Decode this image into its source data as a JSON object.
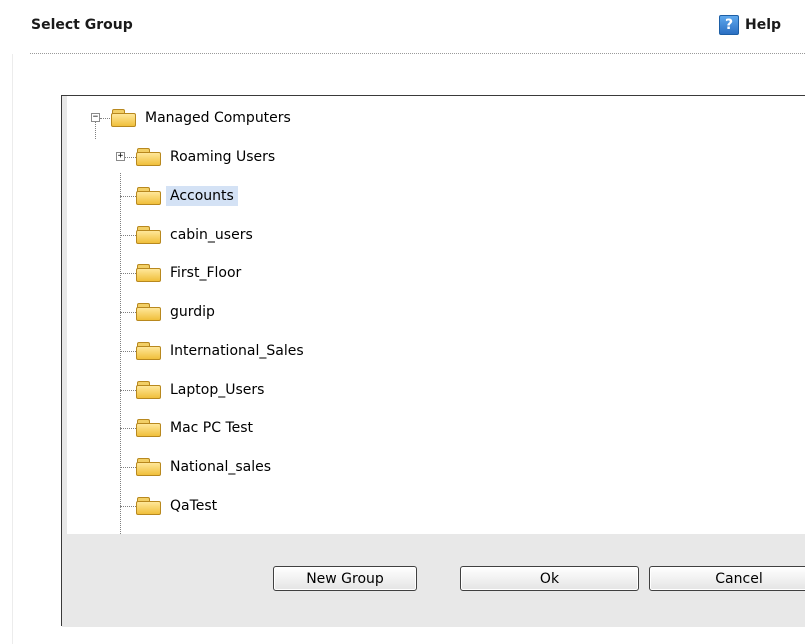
{
  "header": {
    "title": "Select Group",
    "help_label": "Help",
    "help_icon_glyph": "?"
  },
  "tree": {
    "root": {
      "label": "Managed Computers",
      "expander": "−",
      "expanded": true
    },
    "children": [
      {
        "label": "Roaming Users",
        "expander": "+",
        "selected": false
      },
      {
        "label": "Accounts",
        "selected": true
      },
      {
        "label": "cabin_users",
        "selected": false
      },
      {
        "label": "First_Floor",
        "selected": false
      },
      {
        "label": "gurdip",
        "selected": false
      },
      {
        "label": "International_Sales",
        "selected": false
      },
      {
        "label": "Laptop_Users",
        "selected": false
      },
      {
        "label": "Mac PC Test",
        "selected": false
      },
      {
        "label": "National_sales",
        "selected": false
      },
      {
        "label": "QaTest",
        "selected": false
      }
    ]
  },
  "buttons": {
    "new_group": "New Group",
    "ok": "Ok",
    "cancel": "Cancel"
  },
  "colors": {
    "selection": "#d4e2f5",
    "folder": "#f0bf3b",
    "help_icon": "#2b6fc2"
  }
}
